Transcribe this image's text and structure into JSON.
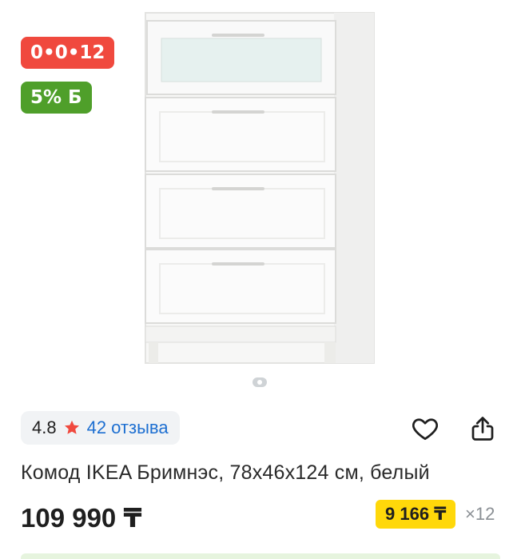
{
  "badges": {
    "installment": "0•0•12",
    "bonus": "5% Б"
  },
  "gallery": {
    "image": "dresser-image"
  },
  "rating": {
    "value": "4.8",
    "reviews": "42 отзыва",
    "star_color": "#f0493e"
  },
  "actions": {
    "favorite": "heart-icon",
    "share": "share-icon"
  },
  "product": {
    "title": "Комод IKEA Бримнэс, 78x46x124 см, белый",
    "price": "109 990 ₸",
    "monthly_payment": "9 166 ₸",
    "months": "×12"
  },
  "colors": {
    "installment_badge": "#f0493e",
    "bonus_badge": "#4f9f2a",
    "link": "#1d6fd1",
    "monthly_badge": "#ffd80a"
  }
}
